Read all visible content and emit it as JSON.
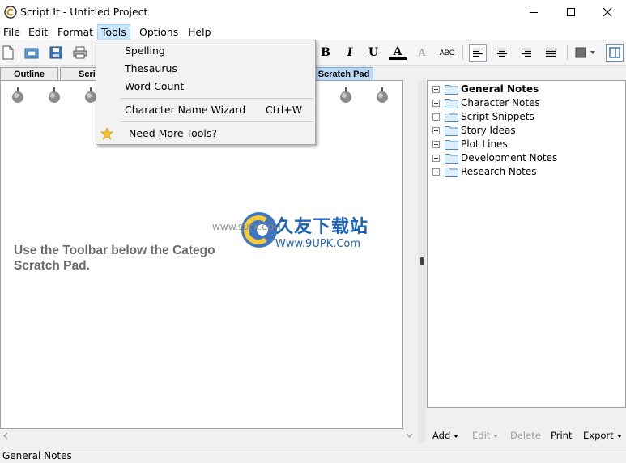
{
  "window": {
    "title": "Script It - Untitled Project",
    "colors": {
      "accent": "#cce8ff",
      "tab_active": "#b9d8f5",
      "hint_text": "#6b6b6b"
    }
  },
  "menubar": {
    "items": [
      {
        "label": "File"
      },
      {
        "label": "Edit"
      },
      {
        "label": "Format"
      },
      {
        "label": "Tools"
      },
      {
        "label": "Options"
      },
      {
        "label": "Help"
      }
    ]
  },
  "toolbar": {
    "left_icons": [
      "new-document-icon",
      "open-folder-icon",
      "save-icon",
      "print-icon"
    ],
    "format_buttons": {
      "bold": "B",
      "italic": "I",
      "underline": "U",
      "font_color": "A",
      "clear_format": "A",
      "spell": "ABC"
    },
    "align_icons": [
      "align-left-icon",
      "align-center-icon",
      "align-right-icon",
      "justify-icon"
    ],
    "right_icons": [
      "color-picker-icon",
      "panel-toggle-icon"
    ]
  },
  "tabs": [
    {
      "label": "Outline"
    },
    {
      "label": "Scrip"
    },
    {
      "label": "Scratch Pad"
    }
  ],
  "left_pane": {
    "hint_line1": "Use the Toolbar below the Catego",
    "hint_line2": "Scratch Pad."
  },
  "tools_menu": {
    "items": [
      {
        "label": "Spelling"
      },
      {
        "label": "Thesaurus"
      },
      {
        "label": "Word Count"
      },
      {
        "label": "Character Name Wizard",
        "shortcut": "Ctrl+W"
      },
      {
        "label": "Need More Tools?",
        "icon": "star-icon"
      }
    ]
  },
  "notes_tree": {
    "items": [
      {
        "label": "General Notes",
        "bold": true
      },
      {
        "label": "Character Notes"
      },
      {
        "label": "Script Snippets"
      },
      {
        "label": "Story Ideas"
      },
      {
        "label": "Plot Lines"
      },
      {
        "label": "Development Notes"
      },
      {
        "label": "Research Notes"
      }
    ]
  },
  "right_tools": {
    "add": "Add",
    "edit": "Edit",
    "delete": "Delete",
    "print": "Print",
    "export": "Export"
  },
  "status": {
    "text": "General Notes"
  },
  "watermark": {
    "cn": "久友下载站",
    "url": "Www.9UPK.Com",
    "small": "WWW.9UPK.COM"
  }
}
